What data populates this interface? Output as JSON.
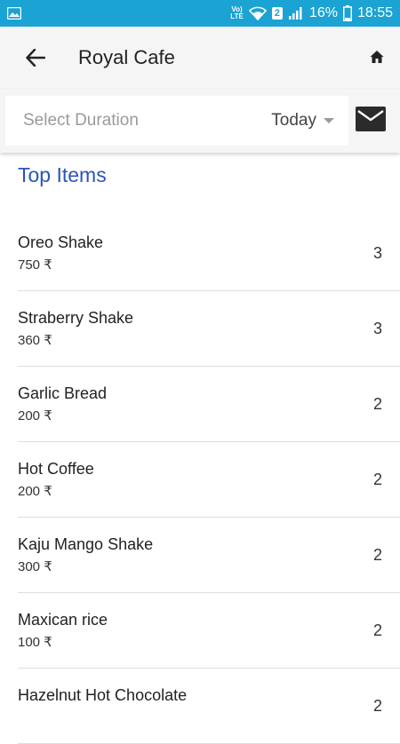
{
  "status_bar": {
    "volte": "Vo) LTE",
    "sim": "2",
    "battery": "16%",
    "time": "18:55"
  },
  "app_bar": {
    "title": "Royal Cafe"
  },
  "filter": {
    "placeholder": "Select Duration",
    "value": "Today"
  },
  "section": {
    "title": "Top Items"
  },
  "items": [
    {
      "name": "Oreo Shake",
      "price": "750 ₹",
      "qty": "3"
    },
    {
      "name": "Straberry Shake",
      "price": "360 ₹",
      "qty": "3"
    },
    {
      "name": "Garlic Bread",
      "price": "200 ₹",
      "qty": "2"
    },
    {
      "name": "Hot Coffee",
      "price": "200 ₹",
      "qty": "2"
    },
    {
      "name": "Kaju Mango Shake",
      "price": "300 ₹",
      "qty": "2"
    },
    {
      "name": "Maxican rice",
      "price": "100 ₹",
      "qty": "2"
    },
    {
      "name": "Hazelnut Hot Chocolate",
      "price": "",
      "qty": "2"
    }
  ],
  "colors": {
    "status_bar": "#1aa3d3",
    "accent_title": "#2a56b8",
    "app_bar_bg": "#f5f5f5"
  },
  "icons": {
    "back": "arrow-left-icon",
    "home": "home-icon",
    "mail": "mail-icon",
    "gallery": "image-icon",
    "wifi": "wifi-icon",
    "signal": "signal-icon",
    "battery": "battery-icon"
  }
}
